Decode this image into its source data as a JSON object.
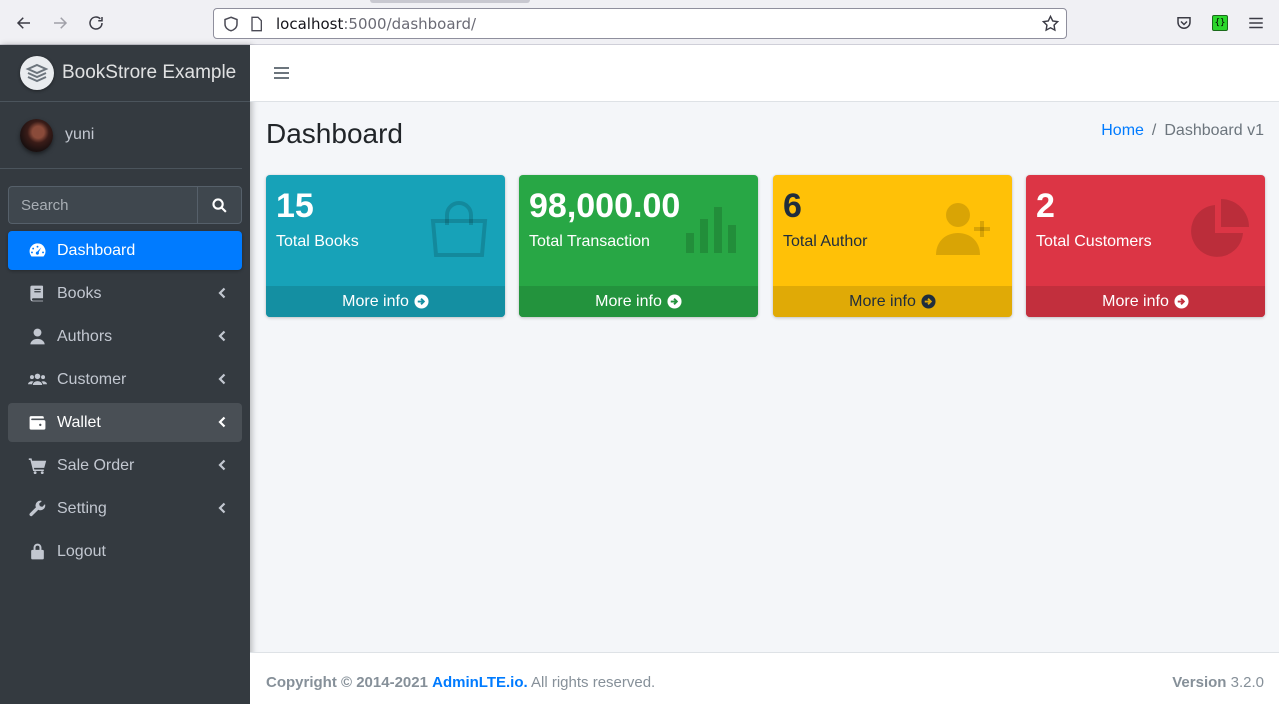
{
  "browser": {
    "url_host": "localhost",
    "url_path": ":5000/dashboard/"
  },
  "brand": {
    "name": "BookStrore Example"
  },
  "user": {
    "name": "yuni"
  },
  "search": {
    "placeholder": "Search"
  },
  "sidebar": {
    "items": [
      {
        "label": "Dashboard",
        "icon": "tachometer-icon",
        "active": true,
        "has_caret": false
      },
      {
        "label": "Books",
        "icon": "book-icon",
        "has_caret": true
      },
      {
        "label": "Authors",
        "icon": "user-icon",
        "has_caret": true
      },
      {
        "label": "Customer",
        "icon": "users-icon",
        "has_caret": true
      },
      {
        "label": "Wallet",
        "icon": "wallet-icon",
        "hover": true,
        "has_caret": true
      },
      {
        "label": "Sale Order",
        "icon": "cart-icon",
        "has_caret": true
      },
      {
        "label": "Setting",
        "icon": "wrench-icon",
        "has_caret": true
      },
      {
        "label": "Logout",
        "icon": "lock-icon",
        "has_caret": false
      }
    ]
  },
  "header": {
    "title": "Dashboard",
    "breadcrumb": {
      "home": "Home",
      "separator": "/",
      "current": "Dashboard v1"
    }
  },
  "stats": [
    {
      "value": "15",
      "label": "Total Books",
      "footer": "More info",
      "color": "#17a2b8",
      "icon": "shopping-bag-icon"
    },
    {
      "value": "98,000.00",
      "label": "Total Transaction",
      "footer": "More info",
      "color": "#28a745",
      "icon": "bar-chart-icon"
    },
    {
      "value": "6",
      "label": "Total Author",
      "footer": "More info",
      "color": "#ffc107",
      "icon": "user-plus-icon"
    },
    {
      "value": "2",
      "label": "Total Customers",
      "footer": "More info",
      "color": "#dc3545",
      "icon": "pie-chart-icon"
    }
  ],
  "footer": {
    "copyright": "Copyright © 2014-2021",
    "link": "AdminLTE.io.",
    "rights": "All rights reserved.",
    "version_label": "Version",
    "version": "3.2.0"
  }
}
